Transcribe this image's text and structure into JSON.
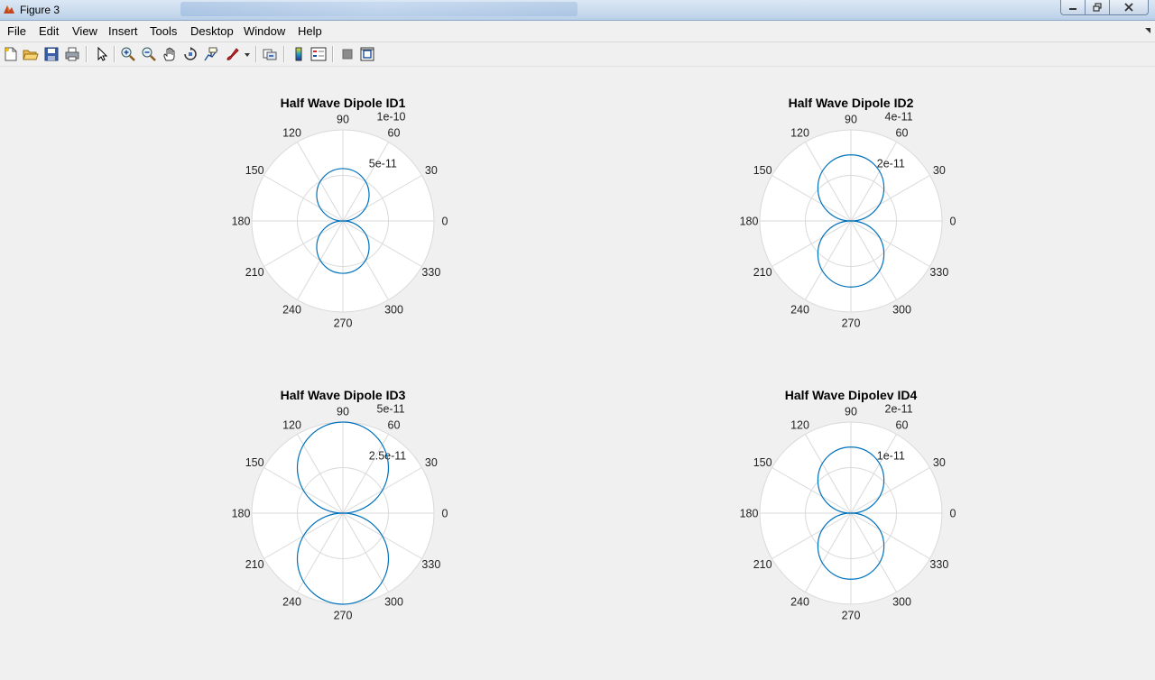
{
  "window": {
    "title": "Figure 3",
    "icon": "matlab-figure-icon"
  },
  "menu": [
    "File",
    "Edit",
    "View",
    "Insert",
    "Tools",
    "Desktop",
    "Window",
    "Help"
  ],
  "toolbar": [
    "new-figure-icon",
    "open-file-icon",
    "save-icon",
    "print-icon",
    "edit-plot-arrow-icon",
    "zoom-in-icon",
    "zoom-out-icon",
    "pan-hand-icon",
    "rotate-3d-icon",
    "data-cursor-icon",
    "brush-icon",
    "link-plot-icon",
    "colorbar-icon",
    "legend-icon",
    "hide-plot-tools-icon",
    "show-plot-tools-icon"
  ],
  "colors": {
    "line": "#0072bd",
    "grid": "#d9d9d9",
    "axes_bg": "#ffffff",
    "figure_bg": "#f0f0f0"
  },
  "chart_data": [
    {
      "type": "polar",
      "title": "Half Wave Dipole ID1",
      "angle_ticks": [
        "0",
        "30",
        "60",
        "90",
        "120",
        "150",
        "180",
        "210",
        "240",
        "270",
        "300",
        "330"
      ],
      "rlim": [
        0,
        1e-10
      ],
      "r_tick_labels": [
        "5e-11",
        "1e-10"
      ],
      "series": [
        {
          "pattern": "sin-theta",
          "peak": 5.75e-11,
          "orientation": "vertical-lobes"
        }
      ]
    },
    {
      "type": "polar",
      "title": "Half Wave Dipole ID2",
      "angle_ticks": [
        "0",
        "30",
        "60",
        "90",
        "120",
        "150",
        "180",
        "210",
        "240",
        "270",
        "300",
        "330"
      ],
      "rlim": [
        0,
        4e-11
      ],
      "r_tick_labels": [
        "2e-11",
        "4e-11"
      ],
      "series": [
        {
          "pattern": "sin-theta",
          "peak": 2.9e-11,
          "orientation": "vertical-lobes"
        }
      ]
    },
    {
      "type": "polar",
      "title": "Half Wave Dipole ID3",
      "angle_ticks": [
        "0",
        "30",
        "60",
        "90",
        "120",
        "150",
        "180",
        "210",
        "240",
        "270",
        "300",
        "330"
      ],
      "rlim": [
        0,
        5e-11
      ],
      "r_tick_labels": [
        "2.5e-11",
        "5e-11"
      ],
      "series": [
        {
          "pattern": "sin-theta",
          "peak": 5e-11,
          "orientation": "vertical-lobes"
        }
      ]
    },
    {
      "type": "polar",
      "title": "Half Wave Dipolev ID4",
      "angle_ticks": [
        "0",
        "30",
        "60",
        "90",
        "120",
        "150",
        "180",
        "210",
        "240",
        "270",
        "300",
        "330"
      ],
      "rlim": [
        0,
        2e-11
      ],
      "r_tick_labels": [
        "1e-11",
        "2e-11"
      ],
      "series": [
        {
          "pattern": "sin-theta",
          "peak": 1.45e-11,
          "orientation": "vertical-lobes"
        }
      ]
    }
  ]
}
